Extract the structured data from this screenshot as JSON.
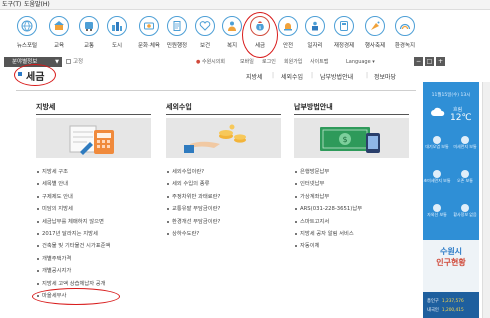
{
  "menu": [
    "도구(T)",
    "도움말(H)"
  ],
  "icons": [
    {
      "label": "뉴스포털",
      "icon": "globe-icon"
    },
    {
      "label": "교육",
      "icon": "school-icon"
    },
    {
      "label": "교통",
      "icon": "bus-icon"
    },
    {
      "label": "도시",
      "icon": "city-icon"
    },
    {
      "label": "문화·체육",
      "icon": "culture-icon"
    },
    {
      "label": "민원행정",
      "icon": "document-icon"
    },
    {
      "label": "보건",
      "icon": "heart-icon"
    },
    {
      "label": "복지",
      "icon": "person-icon"
    },
    {
      "label": "세금",
      "icon": "money-bag-icon",
      "active": true
    },
    {
      "label": "안전",
      "icon": "siren-icon"
    },
    {
      "label": "일자리",
      "icon": "job-icon"
    },
    {
      "label": "재정경제",
      "icon": "calculator-icon"
    },
    {
      "label": "행사축제",
      "icon": "festival-icon"
    },
    {
      "label": "환경녹지",
      "icon": "rainbow-icon"
    }
  ],
  "utility": {
    "select_label": "분야별정보",
    "checkbox_label": "고정",
    "links": [
      "수원시의회",
      "모바일",
      "로그인",
      "회원가입",
      "사이트맵"
    ],
    "language": "Language",
    "brand_color": "#2f8fd6",
    "highlight_color": "#d81a1a"
  },
  "page": {
    "title": "세금",
    "tabs": [
      "지방세",
      "세외수입",
      "납부방법안내",
      "정보마당"
    ]
  },
  "columns": [
    {
      "title": "지방세",
      "items": [
        "지방세 구조",
        "세목별 안내",
        "구제제도 안내",
        "미담의 지방세",
        "세금납부를 체매하지 않으면",
        "2017년 달라지는 지방세",
        "건축물 및 기타물건 시가표준액",
        "개별주택가격",
        "개별공시지가",
        "지방세 고액 상습체납자 공개",
        "마을세무사"
      ]
    },
    {
      "title": "세외수입",
      "items": [
        "세외수입이란?",
        "세외 수입의 종류",
        "주정차위반 과태료란?",
        "교통유발 부담금이란?",
        "환경개선 부담금이란?",
        "상하수도란?"
      ]
    },
    {
      "title": "납부방법안내",
      "items": [
        "은행방문납부",
        "인터넷납부",
        "가상계좌납부",
        "ARS(031-228-3651)납부",
        "스마트고지서",
        "지방세 공자 알림 서비스",
        "자동이체"
      ]
    }
  ],
  "sidebar": {
    "date": "11월15일(수) 13시",
    "weather_label": "흐림",
    "temperature": "12℃",
    "cells": [
      "대기오염 보통",
      "미세먼지 보통",
      "초미세먼지 보통",
      "오존 보통",
      "자외선 보통",
      "황사정보 없음"
    ],
    "logo_top": "수원시",
    "logo_bottom": "인구현황",
    "stats": [
      {
        "label": "총인구",
        "value": "1,237,576"
      },
      {
        "label": "내국인",
        "value": "1,200,415"
      }
    ]
  }
}
